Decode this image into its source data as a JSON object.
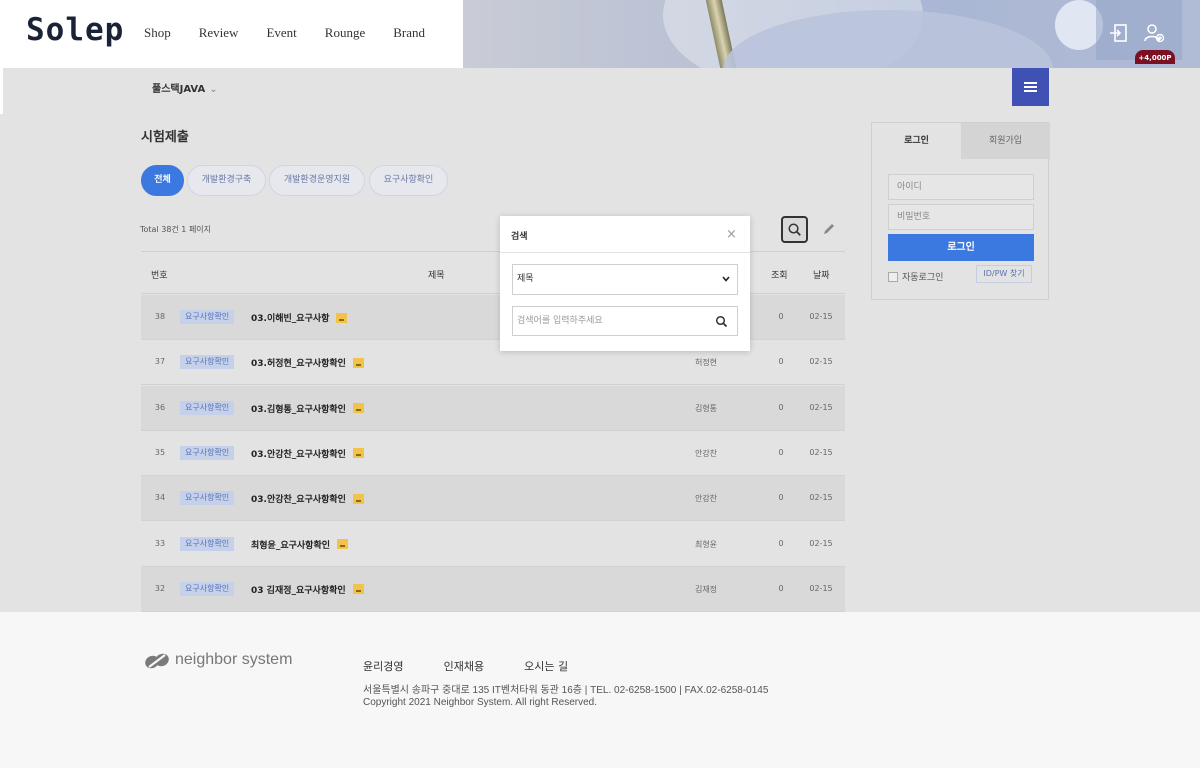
{
  "header": {
    "logo": "Solep",
    "nav": [
      "Shop",
      "Review",
      "Event",
      "Rounge",
      "Brand"
    ],
    "points_badge": "+4,000P"
  },
  "subbar": {
    "course": "풀스택JAVA",
    "course_chevron": "⌄"
  },
  "main": {
    "title": "시험제출",
    "tabs": [
      "전체",
      "개발환경구축",
      "개발환경운영지원",
      "요구사항확인"
    ],
    "active_tab": "전체",
    "total": "Total 38건 1 페이지",
    "columns": {
      "num": "번호",
      "title": "제목",
      "views": "조회",
      "date": "날짜"
    },
    "rows": [
      {
        "num": "38",
        "badge": "요구사항확인",
        "title": "03.이해빈_요구사항",
        "author": "",
        "views": "0",
        "date": "02-15"
      },
      {
        "num": "37",
        "badge": "요구사항확인",
        "title": "03.허정현_요구사항확인",
        "author": "허정현",
        "views": "0",
        "date": "02-15"
      },
      {
        "num": "36",
        "badge": "요구사항확인",
        "title": "03.김형통_요구사항확인",
        "author": "김형통",
        "views": "0",
        "date": "02-15"
      },
      {
        "num": "35",
        "badge": "요구사항확인",
        "title": "03.안강찬_요구사항확인",
        "author": "안강찬",
        "views": "0",
        "date": "02-15"
      },
      {
        "num": "34",
        "badge": "요구사항확인",
        "title": "03.안강찬_요구사항확인",
        "author": "안강찬",
        "views": "0",
        "date": "02-15"
      },
      {
        "num": "33",
        "badge": "요구사항확인",
        "title": "최형윤_요구사항확인",
        "author": "최형윤",
        "views": "0",
        "date": "02-15"
      },
      {
        "num": "32",
        "badge": "요구사항확인",
        "title": "03 김재정_요구사항확인",
        "author": "김재정",
        "views": "0",
        "date": "02-15"
      }
    ]
  },
  "search_modal": {
    "title": "검색",
    "close": "×",
    "select_value": "제목",
    "placeholder": "검색어를 입력하주세요"
  },
  "login": {
    "tab_login": "로그인",
    "tab_signup": "회원가입",
    "id_placeholder": "아이디",
    "pw_placeholder": "비밀번호",
    "button": "로그인",
    "auto_login": "자동로그인",
    "find": "ID/PW 찾기"
  },
  "footer": {
    "logo_text": "neighbor system",
    "links": [
      "윤리경영",
      "인재채용",
      "오시는 길"
    ],
    "address": "서울특별시 송파구 중대로 135 IT벤처타워 동관 16층  |  TEL. 02-6258-1500  |  FAX.02-6258-0145",
    "copyright": "Copyright 2021 Neighbor System. All right Reserved."
  },
  "colors": {
    "accent": "#3b78e0",
    "menu_button": "#3f51b5",
    "badge_bg": "#c5d1ea",
    "points_badge": "#7a1022"
  }
}
